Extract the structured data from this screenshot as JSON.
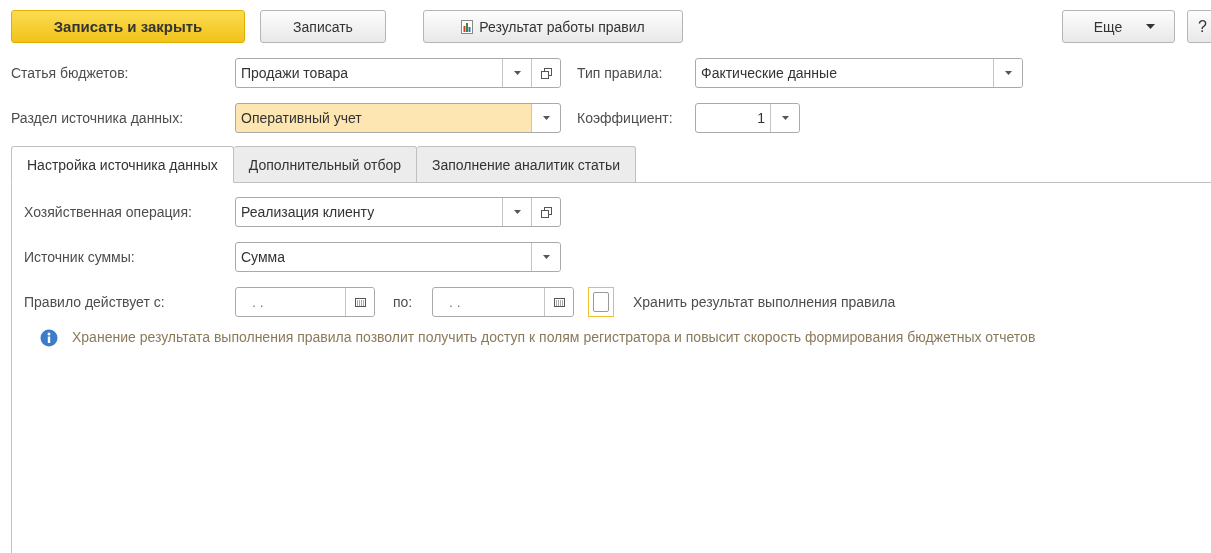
{
  "toolbar": {
    "buttons": [
      {
        "label": "Записать и закрыть",
        "kind": "primary"
      },
      {
        "label": "Записать",
        "kind": "plain"
      },
      {
        "label": "Результат работы правил",
        "kind": "report"
      }
    ],
    "more": {
      "label": "Еще"
    },
    "help": {
      "label": "?"
    }
  },
  "header": {
    "budget_item": {
      "label": "Статья бюджетов:",
      "value": "Продажи товара",
      "highlighted": false
    },
    "rule_type": {
      "label": "Тип правила:",
      "value": "Фактические данные"
    },
    "data_source_section": {
      "label": "Раздел источника данных:",
      "value": "Оперативный учет",
      "highlighted": true
    },
    "coefficient": {
      "label": "Коэффициент:",
      "value": "1"
    }
  },
  "tabs": [
    {
      "label": "Настройка источника данных",
      "selected": true
    },
    {
      "label": "Дополнительный отбор",
      "selected": false
    },
    {
      "label": "Заполнение аналитик статьи",
      "selected": false
    }
  ],
  "panel": {
    "operation": {
      "label": "Хозяйственная операция:",
      "value": "Реализация клиенту"
    },
    "amount_source": {
      "label": "Источник суммы:",
      "value": "Сумма"
    },
    "valid_from": {
      "label": "Правило действует с:",
      "value": ".  ."
    },
    "valid_to": {
      "label": "по:",
      "value": ".  ."
    },
    "store_result": {
      "label": "Хранить результат выполнения правила",
      "checked": false
    },
    "info": "Хранение результата выполнения правила позволит получить доступ к полям регистратора и повысит скорость формирования бюджетных отчетов"
  }
}
